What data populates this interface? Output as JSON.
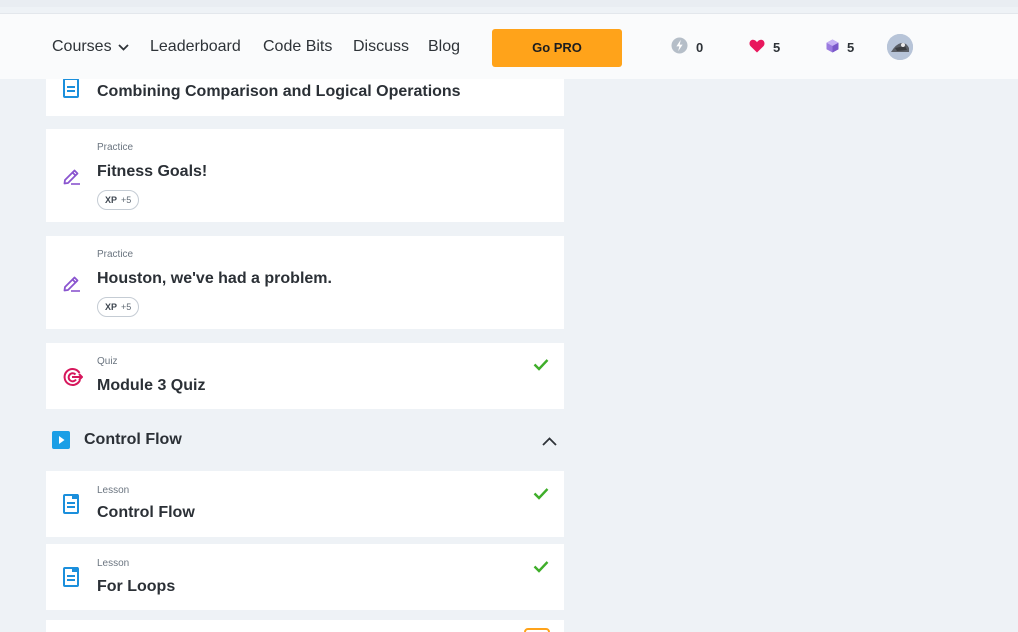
{
  "nav": {
    "courses": "Courses",
    "leaderboard": "Leaderboard",
    "code_bits": "Code Bits",
    "discuss": "Discuss",
    "blog": "Blog",
    "go_pro": "Go PRO",
    "stats": {
      "bolt": "0",
      "hearts": "5",
      "gems": "5"
    },
    "icons": [
      "chevron-down-icon",
      "bolt-icon",
      "heart-icon",
      "gem-icon",
      "avatar"
    ]
  },
  "cards": [
    {
      "kind": "",
      "title": "Combining Comparison and Logical Operations",
      "icon": "lesson-icon"
    },
    {
      "kind": "Practice",
      "title": "Fitness Goals!",
      "xp_label": "XP",
      "xp_value": "+5",
      "icon": "practice-pencil-icon"
    },
    {
      "kind": "Practice",
      "title": "Houston, we've had a problem.",
      "xp_label": "XP",
      "xp_value": "+5",
      "icon": "practice-pencil-icon"
    },
    {
      "kind": "Quiz",
      "title": "Module 3 Quiz",
      "icon": "quiz-target-icon",
      "completed": true
    }
  ],
  "section": {
    "title": "Control Flow",
    "expanded": true
  },
  "section_cards": [
    {
      "kind": "Lesson",
      "title": "Control Flow",
      "icon": "lesson-icon",
      "completed": true
    },
    {
      "kind": "Lesson",
      "title": "For Loops",
      "icon": "lesson-icon",
      "completed": true
    }
  ],
  "colors": {
    "background": "#eef2f6",
    "accent_pro": "#ffa31a",
    "lesson_icon": "#1b8fdc",
    "practice_icon": "#8a55cf",
    "quiz_icon": "#d6175c",
    "check": "#3fae2a",
    "section_icon": "#1b9fe6"
  }
}
